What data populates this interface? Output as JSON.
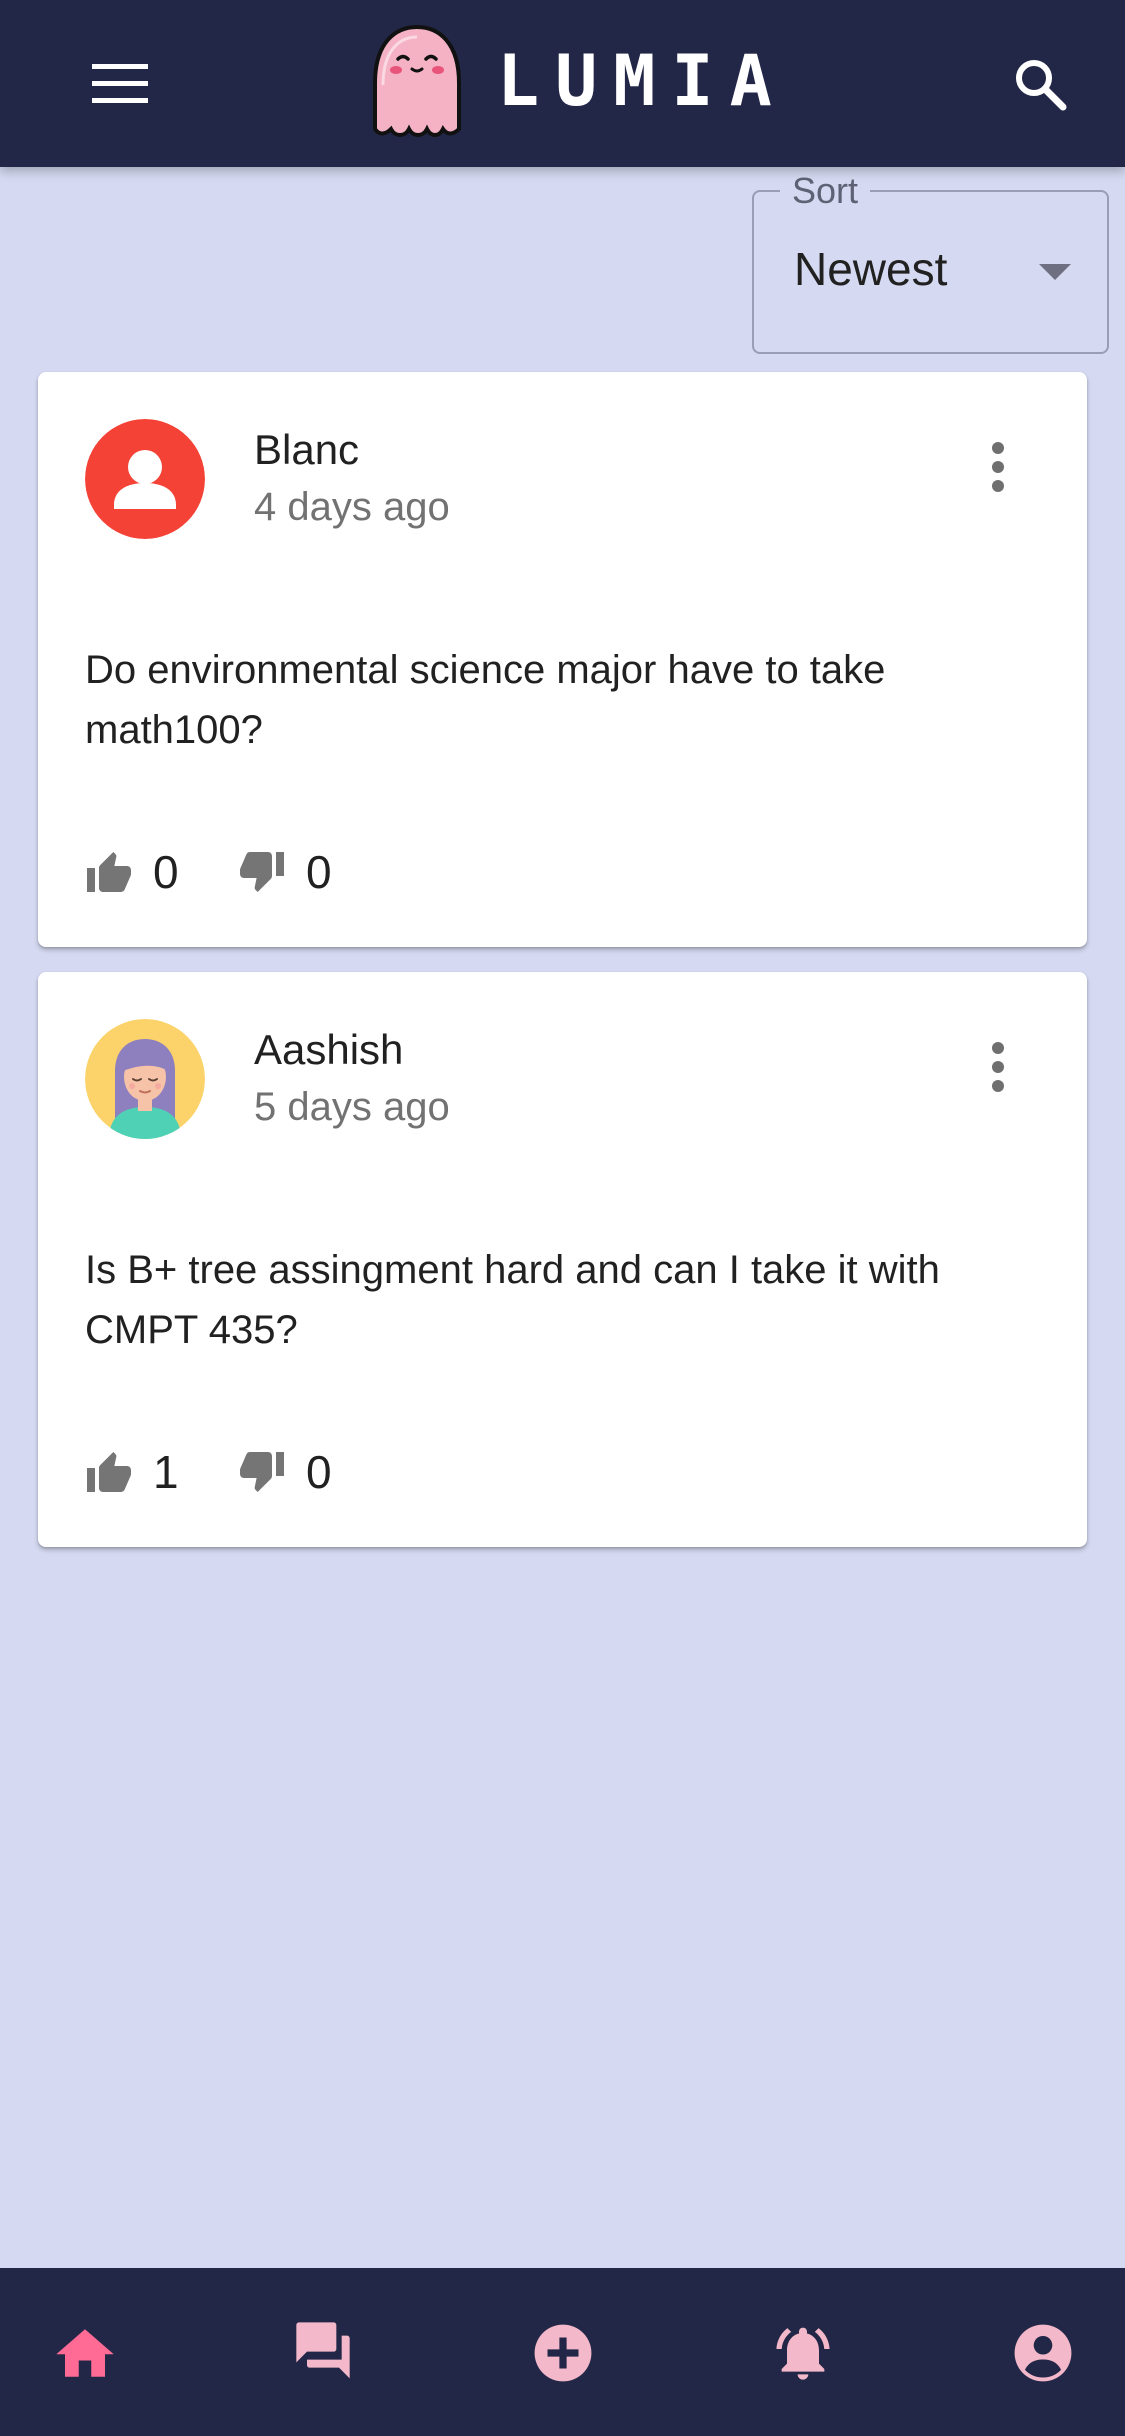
{
  "app": {
    "brand": "LUMIA"
  },
  "sort": {
    "label": "Sort",
    "value": "Newest"
  },
  "posts": [
    {
      "author": "Blanc",
      "time": "4 days ago",
      "text": "Do environmental science major have to take math100?",
      "upvotes": "0",
      "downvotes": "0",
      "avatar": "default-person-avatar",
      "avatar_color": "#f44336"
    },
    {
      "author": "Aashish",
      "time": "5 days ago",
      "text": "Is B+ tree assingment hard and can I take it with CMPT 435?",
      "upvotes": "1",
      "downvotes": "0",
      "avatar": "illustrated-woman-avatar",
      "avatar_color": "#fcd36a"
    }
  ],
  "bottom_nav": {
    "items": [
      "home-icon",
      "forum-icon",
      "add-circle-icon",
      "notifications-icon",
      "account-circle-icon"
    ],
    "active": "home-icon",
    "active_color": "#ff6b95",
    "inactive_color": "#f3b8c9"
  },
  "colors": {
    "appbar": "#232747",
    "background": "#d5d9f1",
    "card": "#ffffff"
  }
}
